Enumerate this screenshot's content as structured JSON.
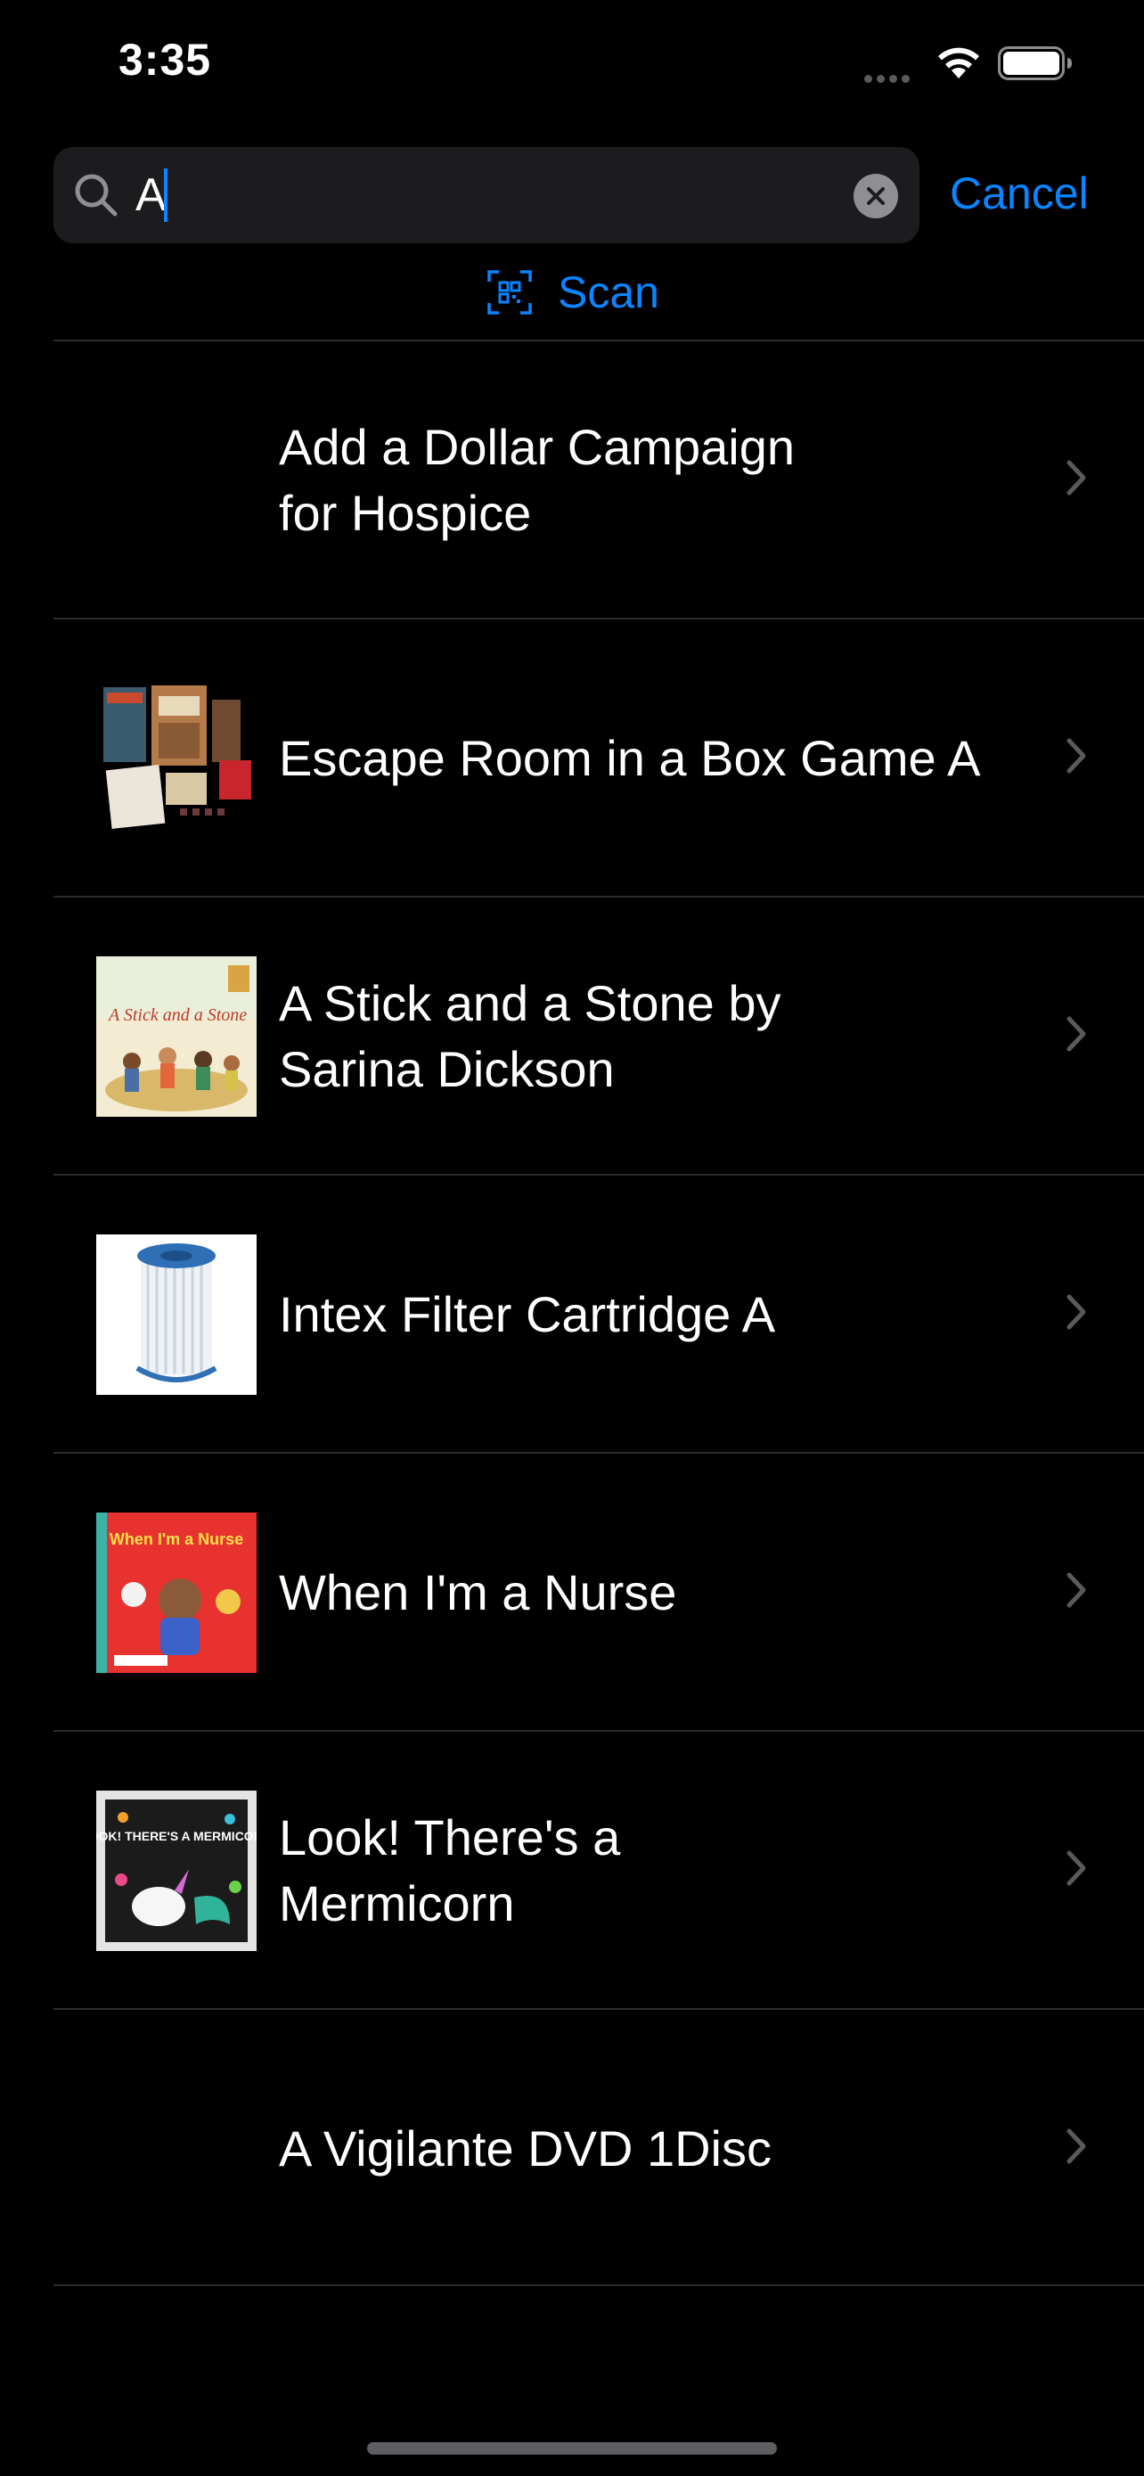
{
  "status_bar": {
    "time": "3:35"
  },
  "search": {
    "value": "A",
    "cancel_label": "Cancel"
  },
  "scan": {
    "label": "Scan"
  },
  "colors": {
    "accent": "#0a84ff",
    "background": "#000000",
    "field": "#1c1c1e",
    "separator": "#2c2c2e"
  },
  "results": [
    {
      "title": "Add a Dollar Campaign for Hospice",
      "thumbnail": "none"
    },
    {
      "title": "Escape Room in a Box Game A",
      "thumbnail": "game-box-photo"
    },
    {
      "title": "A Stick and a Stone by Sarina Dickson",
      "thumbnail": "book-cover",
      "cover_text": "A Stick and a Stone"
    },
    {
      "title": "Intex Filter Cartridge A",
      "thumbnail": "filter-cartridge-photo"
    },
    {
      "title": "When I'm a Nurse",
      "thumbnail": "book-cover",
      "cover_text": "When I'm a Nurse"
    },
    {
      "title": "Look! There's a Mermicorn",
      "thumbnail": "book-cover",
      "cover_text": "LOOK! THERE'S A MERMICORN"
    },
    {
      "title": "A Vigilante DVD 1Disc",
      "thumbnail": "none"
    }
  ]
}
